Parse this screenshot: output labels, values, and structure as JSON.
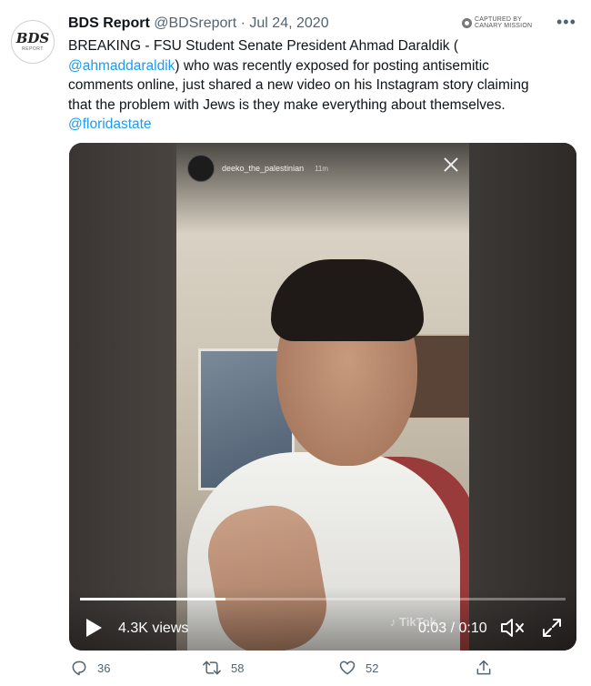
{
  "account": {
    "avatar_big": "BDS",
    "avatar_small": "REPORT",
    "name": "BDS Report",
    "handle": "@BDSreport",
    "separator": "·",
    "date": "Jul 24, 2020"
  },
  "watermark": {
    "line1": "CAPTURED BY",
    "line2": "CANARY MISSION"
  },
  "more_menu": "•••",
  "tweet": {
    "line1": "BREAKING - FSU Student Senate President Ahmad Daraldik (",
    "mention1": "@ahmaddaraldik",
    "line2_rest": ") who was recently exposed for posting antisemitic",
    "line3": "comments online, just shared a new video on his Instagram story claiming",
    "line4": "that the problem with Jews is they make everything about themselves.",
    "mention2": "@floridastate"
  },
  "video": {
    "story_user": "deeko_the_palestinian",
    "story_time": "11m",
    "views": "4.3K views",
    "timecode": "0:03 / 0:10",
    "progress": 0.3,
    "tiktok_mark": "♪ TikTok"
  },
  "actions": {
    "replies": "36",
    "retweets": "58",
    "likes": "52"
  },
  "colors": {
    "link": "#1d9bf0",
    "muted": "#536471"
  }
}
